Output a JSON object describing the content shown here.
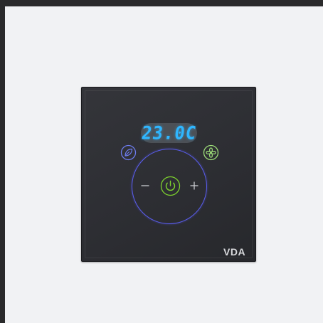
{
  "thermostat": {
    "temperature_display": "23.0C",
    "brand_logo": "VDA",
    "controls": {
      "eco_icon": "leaf-icon",
      "fan_icon": "fan-icon",
      "power_icon": "power-icon",
      "decrease_icon": "minus-icon",
      "increase_icon": "plus-icon"
    },
    "colors": {
      "display_text": "#2fb6ff",
      "ring": "#5b5ef0",
      "power": "#7ed32e",
      "fan": "#9fe07a",
      "eco": "#6e7cf0",
      "panel": "#2d2e33",
      "wall": "#f1f2f4"
    }
  }
}
